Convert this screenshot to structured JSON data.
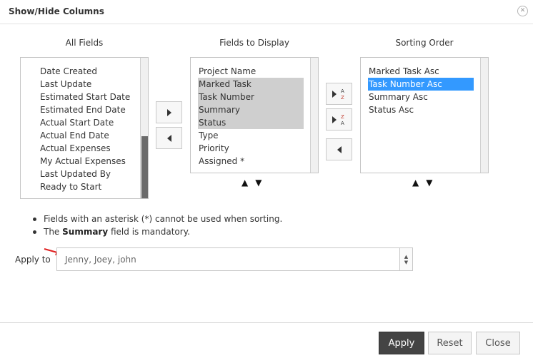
{
  "dialog": {
    "title": "Show/Hide Columns",
    "close_icon": "close-circle-icon"
  },
  "columns": {
    "all_fields": "All Fields",
    "fields_to_display": "Fields to Display",
    "sorting_order": "Sorting Order"
  },
  "all_fields": {
    "items": [
      "Date Created",
      "Last Update",
      "Estimated Start Date",
      "Estimated End Date",
      "Actual Start Date",
      "Actual End Date",
      "Actual Expenses",
      "My Actual Expenses",
      "Last Updated By",
      "Ready to Start"
    ]
  },
  "fields_to_display": {
    "items": [
      {
        "label": "Project Name",
        "selected": false
      },
      {
        "label": "Marked Task",
        "selected": true
      },
      {
        "label": "Task Number",
        "selected": true
      },
      {
        "label": "Summary",
        "selected": true
      },
      {
        "label": "Status",
        "selected": true
      },
      {
        "label": "Type",
        "selected": false
      },
      {
        "label": "Priority",
        "selected": false
      },
      {
        "label": "Assigned *",
        "selected": false
      }
    ]
  },
  "sorting_order": {
    "items": [
      {
        "label": "Marked Task Asc",
        "selected": false
      },
      {
        "label": "Task Number Asc",
        "selected": true
      },
      {
        "label": "Summary Asc",
        "selected": false
      },
      {
        "label": "Status Asc",
        "selected": false
      }
    ]
  },
  "reorder": {
    "up": "▲",
    "down": "▼"
  },
  "sort_buttons": {
    "asc_top": "A",
    "asc_bottom": "Z",
    "desc_top": "Z",
    "desc_bottom": "A"
  },
  "notes": {
    "line1": "Fields with an asterisk (*) cannot be used when sorting.",
    "line2_prefix": "The ",
    "line2_bold": "Summary",
    "line2_suffix": " field is mandatory."
  },
  "apply_to": {
    "label": "Apply to",
    "value": "Jenny, Joey, john"
  },
  "footer": {
    "apply": "Apply",
    "reset": "Reset",
    "close": "Close"
  },
  "colors": {
    "accent": "#3399ff",
    "selection_gray": "#cfcfcf",
    "primary_button": "#444444",
    "annotation_arrow": "#e02020"
  }
}
